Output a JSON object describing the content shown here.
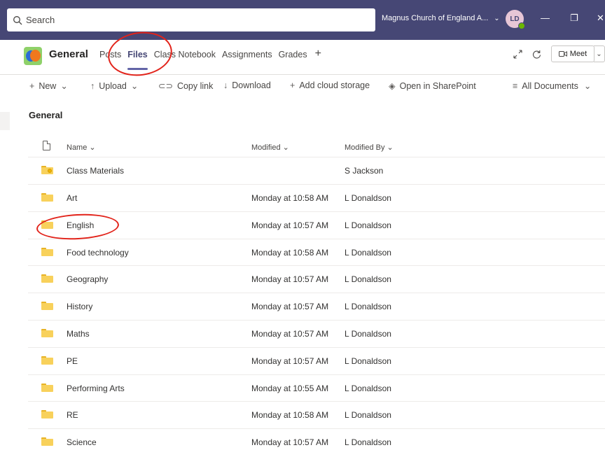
{
  "topbar": {
    "search_placeholder": "Search",
    "org_name": "Magnus Church of England A...",
    "avatar_initials": "LD",
    "minimize_glyph": "—",
    "restore_glyph": "❐",
    "close_glyph": "✕"
  },
  "channel": {
    "name": "General",
    "tabs": [
      {
        "label": "Posts",
        "active": false
      },
      {
        "label": "Files",
        "active": true
      },
      {
        "label": "Class Notebook",
        "active": false
      },
      {
        "label": "Assignments",
        "active": false
      },
      {
        "label": "Grades",
        "active": false
      }
    ],
    "add_tab_glyph": "+",
    "meet_label": "Meet"
  },
  "commands": {
    "new": "New",
    "upload": "Upload",
    "copy_link": "Copy link",
    "download": "Download",
    "add_cloud": "Add cloud storage",
    "open_sharepoint": "Open in SharePoint",
    "view": "All Documents"
  },
  "breadcrumb": "General",
  "table": {
    "headers": {
      "name": "Name",
      "modified": "Modified",
      "modified_by": "Modified By"
    },
    "rows": [
      {
        "name": "Class Materials",
        "modified": "",
        "modified_by": "S Jackson",
        "shared": true
      },
      {
        "name": "Art",
        "modified": "Monday at 10:58 AM",
        "modified_by": "L Donaldson",
        "shared": false
      },
      {
        "name": "English",
        "modified": "Monday at 10:57 AM",
        "modified_by": "L Donaldson",
        "shared": false
      },
      {
        "name": "Food technology",
        "modified": "Monday at 10:58 AM",
        "modified_by": "L Donaldson",
        "shared": false
      },
      {
        "name": "Geography",
        "modified": "Monday at 10:57 AM",
        "modified_by": "L Donaldson",
        "shared": false
      },
      {
        "name": "History",
        "modified": "Monday at 10:57 AM",
        "modified_by": "L Donaldson",
        "shared": false
      },
      {
        "name": "Maths",
        "modified": "Monday at 10:57 AM",
        "modified_by": "L Donaldson",
        "shared": false
      },
      {
        "name": "PE",
        "modified": "Monday at 10:57 AM",
        "modified_by": "L Donaldson",
        "shared": false
      },
      {
        "name": "Performing Arts",
        "modified": "Monday at 10:55 AM",
        "modified_by": "L Donaldson",
        "shared": false
      },
      {
        "name": "RE",
        "modified": "Monday at 10:58 AM",
        "modified_by": "L Donaldson",
        "shared": false
      },
      {
        "name": "Science",
        "modified": "Monday at 10:57 AM",
        "modified_by": "L Donaldson",
        "shared": false
      }
    ]
  },
  "colors": {
    "titlebar": "#464775",
    "accent": "#6264a7",
    "folder": "#f8d15b",
    "annotation": "#e2231a"
  }
}
